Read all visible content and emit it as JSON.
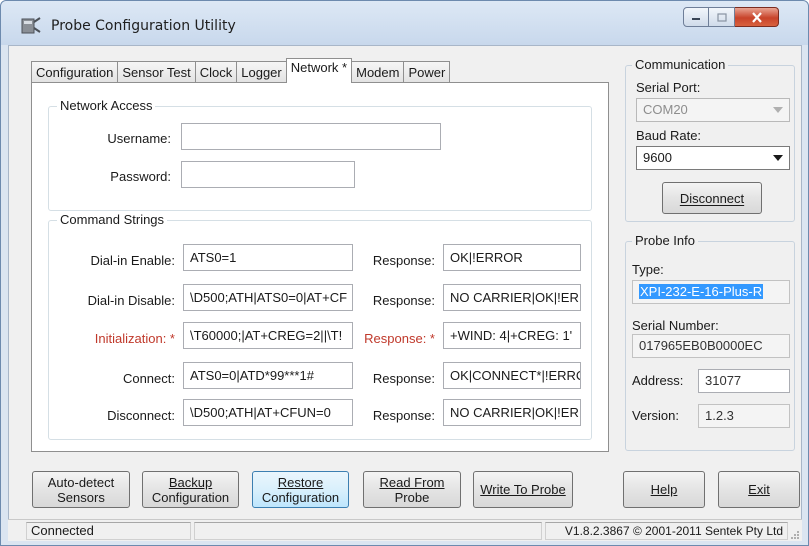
{
  "window": {
    "title": "Probe Configuration Utility",
    "icon": "probe-app-icon",
    "controls": {
      "minimize": "minimize-icon",
      "maximize": "maximize-icon",
      "close": "close-icon"
    }
  },
  "tabs": [
    {
      "label": "Configuration"
    },
    {
      "label": "Sensor Test"
    },
    {
      "label": "Clock"
    },
    {
      "label": "Logger"
    },
    {
      "label": "Network *",
      "active": true
    },
    {
      "label": "Modem"
    },
    {
      "label": "Power"
    }
  ],
  "network_access": {
    "title": "Network Access",
    "username_label": "Username:",
    "username_value": "",
    "password_label": "Password:",
    "password_value": ""
  },
  "command_strings": {
    "title": "Command Strings",
    "rows": [
      {
        "label": "Dial-in Enable:",
        "value": "ATS0=1",
        "response_label": "Response:",
        "response": "OK|!ERROR",
        "required": false
      },
      {
        "label": "Dial-in Disable:",
        "value": "\\D500;ATH|ATS0=0|AT+CF",
        "response_label": "Response:",
        "response": "NO CARRIER|OK|!ERI",
        "required": false
      },
      {
        "label": "Initialization: *",
        "value": "\\T60000;|AT+CREG=2||\\T!",
        "response_label": "Response: *",
        "response": "+WIND: 4|+CREG: 1'",
        "required": true
      },
      {
        "label": "Connect:",
        "value": "ATS0=0|ATD*99***1#",
        "response_label": "Response:",
        "response": "OK|CONNECT*|!ERRC",
        "required": false
      },
      {
        "label": "Disconnect:",
        "value": "\\D500;ATH|AT+CFUN=0",
        "response_label": "Response:",
        "response": "NO CARRIER|OK|!ERI",
        "required": false
      }
    ]
  },
  "communication": {
    "title": "Communication",
    "serial_port_label": "Serial Port:",
    "serial_port_value": "COM20",
    "baud_rate_label": "Baud Rate:",
    "baud_rate_value": "9600",
    "disconnect_label": "Disconnect"
  },
  "probe_info": {
    "title": "Probe Info",
    "type_label": "Type:",
    "type_value": "XPI-232-E-16-Plus-R",
    "serial_number_label": "Serial Number:",
    "serial_number_value": "017965EB0B0000EC",
    "address_label": "Address:",
    "address_value": "31077",
    "version_label": "Version:",
    "version_value": "1.2.3"
  },
  "bottom_buttons": {
    "auto_detect_1": "Auto-detect",
    "auto_detect_2": "Sensors",
    "backup_1": "Backup",
    "backup_2": "Configuration",
    "restore_1": "Restore",
    "restore_2": "Configuration",
    "read_1": "Read From",
    "read_2": "Probe",
    "write": "Write To Probe",
    "help": "Help",
    "exit": "Exit"
  },
  "status_bar": {
    "status": "Connected",
    "version": "V1.8.2.3867 © 2001-2011 Sentek Pty Ltd"
  }
}
